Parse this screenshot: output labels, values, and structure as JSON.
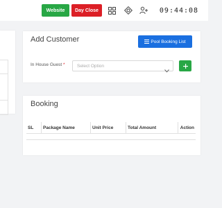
{
  "topbar": {
    "website_label": "Website",
    "day_close_label": "Day Close",
    "clock": "09:44:08",
    "icons": [
      "grid-icon",
      "settings-icon",
      "add-user-icon"
    ]
  },
  "customer": {
    "title": "Add Customer",
    "pool_booking_label": "Pool Booking List",
    "in_house_label": "In House Guest",
    "required_mark": "*",
    "select_placeholder": "Select Option"
  },
  "booking": {
    "title": "Booking",
    "columns": {
      "sl": "SL",
      "package_name": "Package Name",
      "unit_price": "Unit Price",
      "total_amount": "Total Amount",
      "action": "Action"
    }
  },
  "colors": {
    "website": "#28a745",
    "day_close": "#dc1f26",
    "primary": "#1a6fe0",
    "background": "#f2f3f5"
  }
}
